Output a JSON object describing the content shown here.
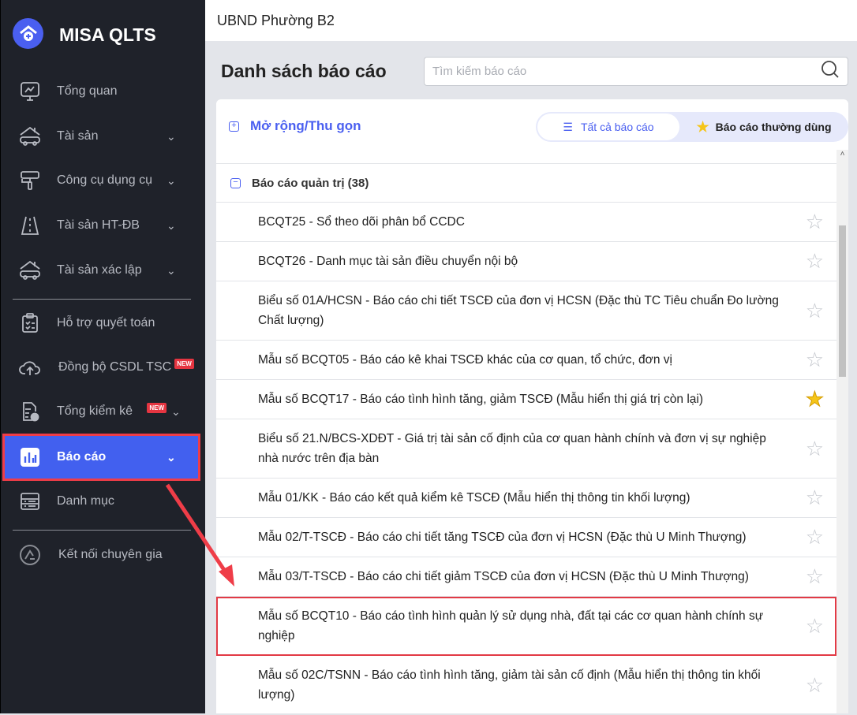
{
  "app": {
    "brand": "MISA QLTS",
    "org": "UBND Phường B2"
  },
  "sidebar": {
    "items": [
      {
        "label": "Tổng quan"
      },
      {
        "label": "Tài sản"
      },
      {
        "label": "Công cụ dụng cụ"
      },
      {
        "label": "Tài sản HT-ĐB"
      },
      {
        "label": "Tài sản xác lập"
      },
      {
        "label": "Hỗ trợ quyết toán"
      },
      {
        "label": "Đồng bộ CSDL TSC",
        "badge": "NEW"
      },
      {
        "label": "Tổng kiểm kê",
        "badge": "NEW"
      },
      {
        "label": "Báo cáo"
      },
      {
        "label": "Danh mục"
      },
      {
        "label": "Kết nối chuyên gia"
      }
    ]
  },
  "main": {
    "title": "Danh sách báo cáo",
    "search_placeholder": "Tìm kiếm báo cáo",
    "expand_label": "Mở rộng/Thu gọn",
    "tabs": [
      {
        "label": "Tất cả báo cáo",
        "active": true
      },
      {
        "label": "Báo cáo thường dùng"
      }
    ],
    "group": "Báo cáo quản trị (38)",
    "reports": [
      {
        "name": "BCQT25 - Sổ theo dõi phân bổ CCDC",
        "starred": false
      },
      {
        "name": "BCQT26 - Danh mục tài sản điều chuyển nội bộ",
        "starred": false
      },
      {
        "name": "Biểu số 01A/HCSN - Báo cáo chi tiết TSCĐ của đơn vị HCSN (Đặc thù TC Tiêu chuẩn Đo lường Chất lượng)",
        "starred": false
      },
      {
        "name": "Mẫu số BCQT05 - Báo cáo kê khai TSCĐ khác của cơ quan, tổ chức, đơn vị",
        "starred": false
      },
      {
        "name": "Mẫu số BCQT17 - Báo cáo tình hình tăng, giảm TSCĐ (Mẫu hiển thị giá trị còn lại)",
        "starred": true
      },
      {
        "name": "Biểu số 21.N/BCS-XDĐT - Giá trị tài sản cố định của cơ quan hành chính và đơn vị sự nghiệp nhà nước trên địa bàn",
        "starred": false
      },
      {
        "name": "Mẫu 01/KK - Báo cáo kết quả kiểm kê TSCĐ (Mẫu hiển thị thông tin khối lượng)",
        "starred": false
      },
      {
        "name": "Mẫu 02/T-TSCĐ - Báo cáo chi tiết tăng TSCĐ của đơn vị HCSN (Đặc thù U Minh Thượng)",
        "starred": false
      },
      {
        "name": "Mẫu 03/T-TSCĐ - Báo cáo chi tiết giảm TSCĐ của đơn vị HCSN (Đặc thù U Minh Thượng)",
        "starred": false
      },
      {
        "name": "Mẫu số BCQT10 - Báo cáo tình hình quản lý sử dụng nhà, đất tại các cơ quan hành chính sự nghiệp",
        "starred": false
      },
      {
        "name": "Mẫu số 02C/TSNN - Báo cáo tình hình tăng, giảm tài sản cố định (Mẫu hiển thị thông tin khối lượng)",
        "starred": false
      }
    ]
  },
  "colors": {
    "accent": "#4260ef",
    "sidebar": "#1f222a",
    "highlight": "#e23a45"
  }
}
